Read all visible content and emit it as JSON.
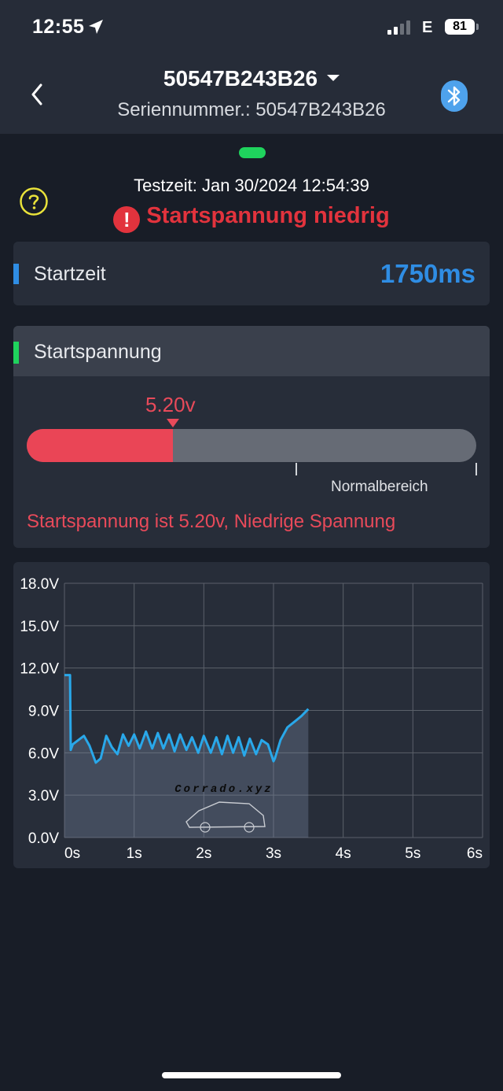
{
  "status_bar": {
    "time": "12:55",
    "network": "E",
    "battery": "81"
  },
  "nav": {
    "title": "50547B243B26",
    "subtitle": "Seriennummer.: 50547B243B26"
  },
  "test": {
    "time_label": "Testzeit: Jan 30/2024 12:54:39",
    "warning": "Startspannung niedrig"
  },
  "startzeit": {
    "label": "Startzeit",
    "value": "1750ms"
  },
  "startspannung": {
    "label": "Startspannung",
    "value": "5.20v",
    "fill_fraction": 0.325,
    "normal_range_label": "Normalbereich",
    "message": "Startspannung ist 5.20v, Niedrige Spannung"
  },
  "colors": {
    "accent_blue": "#2f8de4",
    "accent_green": "#1fd35d",
    "warning_red": "#e2333d",
    "line": "#29a8ea"
  },
  "icons": [
    "location-arrow-icon",
    "signal-icon",
    "back-chevron-icon",
    "dropdown-caret-icon",
    "bluetooth-icon",
    "help-icon",
    "warning-icon"
  ],
  "chart_data": {
    "type": "area",
    "title": "",
    "xlabel": "",
    "ylabel": "",
    "xlim": [
      0,
      6
    ],
    "ylim": [
      0,
      18
    ],
    "x_ticks": [
      "0s",
      "1s",
      "2s",
      "3s",
      "4s",
      "5s",
      "6s"
    ],
    "y_ticks": [
      "0.0V",
      "3.0V",
      "6.0V",
      "9.0V",
      "12.0V",
      "15.0V",
      "18.0V"
    ],
    "grid": true,
    "watermark": "Corrado.xyz",
    "series": [
      {
        "x": [
          0,
          0.08,
          0.09,
          0.12,
          0.2,
          0.28,
          0.36,
          0.45,
          0.52,
          0.6,
          0.68,
          0.76,
          0.84,
          0.92,
          1.0,
          1.08,
          1.17,
          1.26,
          1.34,
          1.42,
          1.5,
          1.58,
          1.66,
          1.75,
          1.83,
          1.92,
          2.0,
          2.1,
          2.18,
          2.26,
          2.34,
          2.42,
          2.5,
          2.58,
          2.66,
          2.75,
          2.83,
          2.92,
          3.0,
          3.02,
          3.1,
          3.2,
          3.3,
          3.4,
          3.5
        ],
        "values": [
          11.5,
          11.5,
          6.2,
          6.6,
          6.9,
          7.2,
          6.5,
          5.3,
          5.6,
          7.2,
          6.4,
          5.9,
          7.3,
          6.5,
          7.3,
          6.3,
          7.5,
          6.3,
          7.4,
          6.3,
          7.3,
          6.1,
          7.3,
          6.2,
          7.1,
          6.0,
          7.2,
          6.0,
          7.1,
          5.9,
          7.2,
          6.0,
          7.1,
          5.8,
          7.0,
          5.9,
          6.9,
          6.6,
          5.4,
          5.6,
          6.9,
          7.8,
          8.2,
          8.6,
          9.1
        ]
      }
    ]
  }
}
